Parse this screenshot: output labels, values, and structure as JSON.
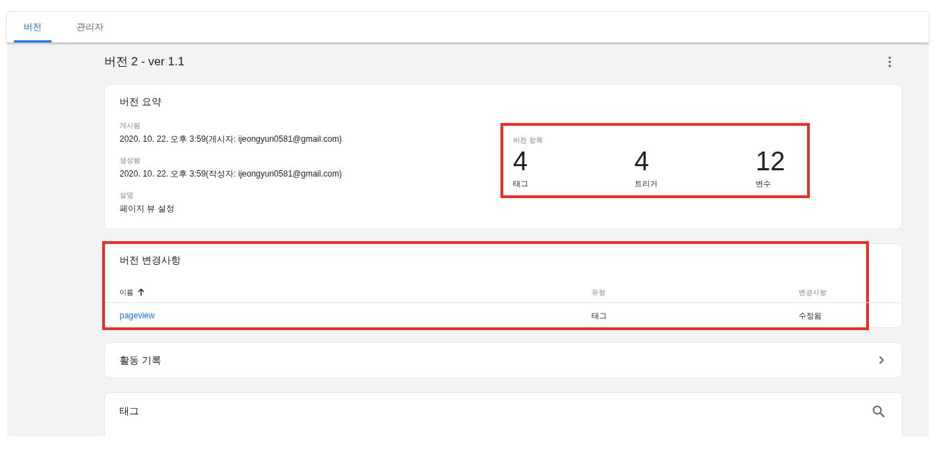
{
  "tabs": [
    {
      "label": "버전",
      "selected": true
    },
    {
      "label": "관리자",
      "selected": false
    }
  ],
  "title": "버전 2 - ver 1.1",
  "summary": {
    "title": "버전 요약",
    "fields": [
      {
        "label": "게시됨",
        "value": "2020. 10. 22. 오후 3:59(게시자: ijeongyun0581@gmail.com)"
      },
      {
        "label": "생성됨",
        "value": "2020. 10. 22. 오후 3:59(작성자: ijeongyun0581@gmail.com)"
      },
      {
        "label": "설명",
        "value": "페이지 뷰 설정"
      }
    ],
    "items": {
      "label": "버전 항목",
      "highlighted": true,
      "counts": [
        {
          "value": "4",
          "label": "태그"
        },
        {
          "value": "4",
          "label": "트리거"
        },
        {
          "value": "12",
          "label": "변수"
        }
      ]
    }
  },
  "changes": {
    "title": "버전 변경사항",
    "highlighted": true,
    "columns": [
      "이름",
      "유형",
      "변경사항"
    ],
    "rows": [
      {
        "name": "pageview",
        "type": "태그",
        "change": "수정됨"
      }
    ]
  },
  "activity": {
    "title": "활동 기록"
  },
  "tags": {
    "title": "태그"
  }
}
